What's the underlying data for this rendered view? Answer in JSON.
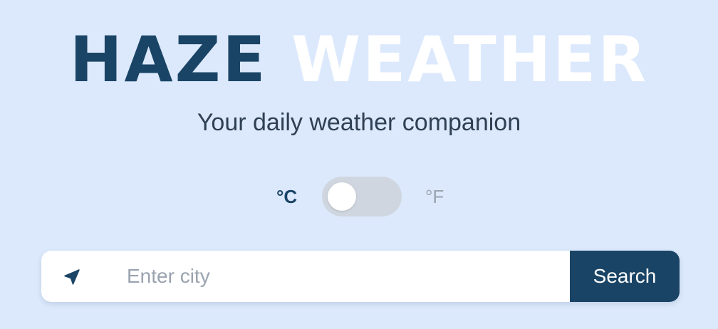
{
  "header": {
    "title_part1": "HAZE",
    "title_part2": "WEATHER",
    "tagline": "Your daily weather companion"
  },
  "units": {
    "celsius_label": "°C",
    "fahrenheit_label": "°F",
    "selected": "celsius"
  },
  "search": {
    "placeholder": "Enter city",
    "value": "",
    "button_label": "Search",
    "location_icon": "location-arrow-icon"
  },
  "colors": {
    "background": "#dce9fc",
    "brand_dark": "#1a4465",
    "brand_light": "#ffffff",
    "toggle_track": "#d0d6df"
  }
}
